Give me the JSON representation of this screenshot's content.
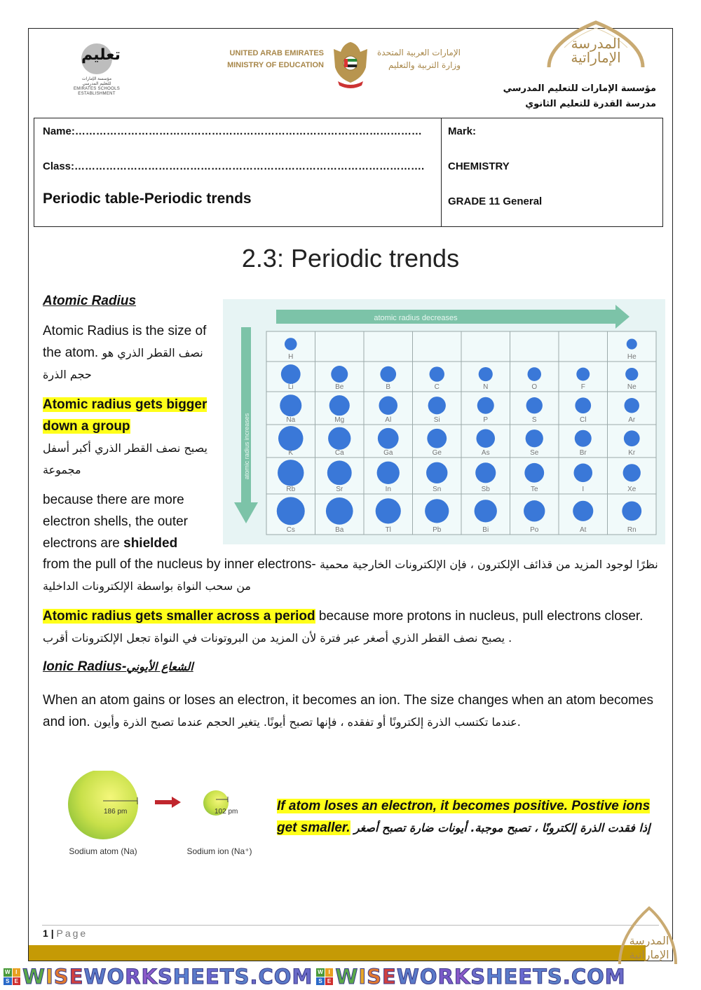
{
  "header": {
    "left_logo": {
      "arabic_mark": "تعليم",
      "caption_lines": [
        "مؤسسة الإمارات",
        "للتعليم المدرسي",
        "EMIRATES SCHOOLS",
        "ESTABLISHMENT"
      ]
    },
    "ministry": {
      "english_lines": [
        "UNITED ARAB EMIRATES",
        "MINISTRY OF EDUCATION"
      ],
      "arabic_lines": [
        "الإمارات العربية المتحدة",
        "وزارة التربية والتعليم"
      ]
    },
    "school_logo": {
      "lines": [
        "المدرسة",
        "الإماراتية"
      ]
    },
    "school_arabic_lines": [
      "مؤسسة الإمارات للتعليم المدرسي",
      "مدرسة القدرة للتعليم الثانوي"
    ]
  },
  "info": {
    "name_label": "Name:………………………………………………………………………………………",
    "class_label": "Class:……………………………………………………………………………………….",
    "worksheet_title": "Periodic table-Periodic trends",
    "mark_label": "Mark:",
    "subject": "CHEMISTRY",
    "grade": "GRADE 11 General"
  },
  "title": "2.3: Periodic trends",
  "atomic_radius": {
    "heading": "Atomic Radius",
    "definition_en": "Atomic Radius is the size of the atom.",
    "definition_ar": "نصف القطر الذري هو حجم الذرة",
    "group_trend_en": "Atomic radius gets bigger down a group",
    "group_trend_ar": "يصبح نصف القطر الذري أكبر أسفل مجموعة",
    "reason_en_1": "because there are more electron shells, the outer electrons are ",
    "reason_en_bold": "shielded",
    "reason_en_2": "from the pull of the nucleus by inner electrons-",
    "reason_ar": "نظرًا لوجود المزيد من قذائف الإلكترون ، فإن الإلكترونات الخارجية محمية من سحب النواة بواسطة الإلكترونات الداخلية",
    "period_trend_en": "Atomic radius gets smaller across a period",
    "period_reason_en": " because more protons in nucleus, pull electrons closer.",
    "period_reason_ar": "يصبح نصف القطر الذري أصغر عبر فترة لأن المزيد من البروتونات في النواة تجعل الإلكترونات أقرب ."
  },
  "periodic_figure": {
    "arrow_horizontal_label": "atomic radius decreases",
    "arrow_vertical_label": "atomic radius increases",
    "rows": [
      [
        "H",
        "",
        "",
        "",
        "",
        "",
        "",
        "He"
      ],
      [
        "Li",
        "Be",
        "B",
        "C",
        "N",
        "O",
        "F",
        "Ne"
      ],
      [
        "Na",
        "Mg",
        "Al",
        "Si",
        "P",
        "S",
        "Cl",
        "Ar"
      ],
      [
        "K",
        "Ca",
        "Ga",
        "Ge",
        "As",
        "Se",
        "Br",
        "Kr"
      ],
      [
        "Rb",
        "Sr",
        "In",
        "Sn",
        "Sb",
        "Te",
        "I",
        "Xe"
      ],
      [
        "Cs",
        "Ba",
        "Tl",
        "Pb",
        "Bi",
        "Po",
        "At",
        "Rn"
      ]
    ],
    "relative_sizes": [
      [
        0.3,
        0,
        0,
        0,
        0,
        0,
        0,
        0.22
      ],
      [
        0.62,
        0.5,
        0.46,
        0.42,
        0.38,
        0.36,
        0.34,
        0.32
      ],
      [
        0.72,
        0.66,
        0.58,
        0.54,
        0.5,
        0.48,
        0.46,
        0.42
      ],
      [
        0.86,
        0.76,
        0.68,
        0.62,
        0.58,
        0.54,
        0.5,
        0.46
      ],
      [
        0.92,
        0.84,
        0.76,
        0.7,
        0.66,
        0.62,
        0.58,
        0.54
      ],
      [
        1.0,
        0.96,
        0.88,
        0.82,
        0.76,
        0.7,
        0.66,
        0.62
      ]
    ],
    "colors": {
      "arrow": "#7cc3a8",
      "atom": "#3a78d8",
      "bg": "#e7f4f4",
      "grid": "#9aa8a8"
    }
  },
  "ionic_radius": {
    "heading_en": "Ionic Radius-",
    "heading_ar": "الشعاع الأيوني",
    "para_en_1": "When an atom gains or loses an electron, it becomes an ion. The size changes when an atom becomes and ion.",
    "para_ar": "عندما تكتسب الذرة إلكترونًا أو تفقده ، فإنها تصبح أيونًا. يتغير الحجم عندما تصبح الذرة وأيون.",
    "figure": {
      "atom_radius_label": "186 pm",
      "ion_radius_label": "102 pm",
      "atom_caption": "Sodium atom (Na)",
      "ion_caption": "Sodium ion (Na⁺)",
      "atom_radius_pm": 186,
      "ion_radius_pm": 102
    },
    "callout_en": "If atom loses an electron, it becomes positive. Postive ions get smaller.",
    "callout_ar": "إذا فقدت الذرة إلكترونًا ، تصبح موجبة. أيونات ضارة تصبح أصغر"
  },
  "footer": {
    "page_number": "1",
    "page_word": "Page",
    "watermark": "WISEWORKSHEETS.COM",
    "watermark_badge": [
      "W",
      "I",
      "S",
      "E"
    ],
    "gold": "#c59a05"
  }
}
